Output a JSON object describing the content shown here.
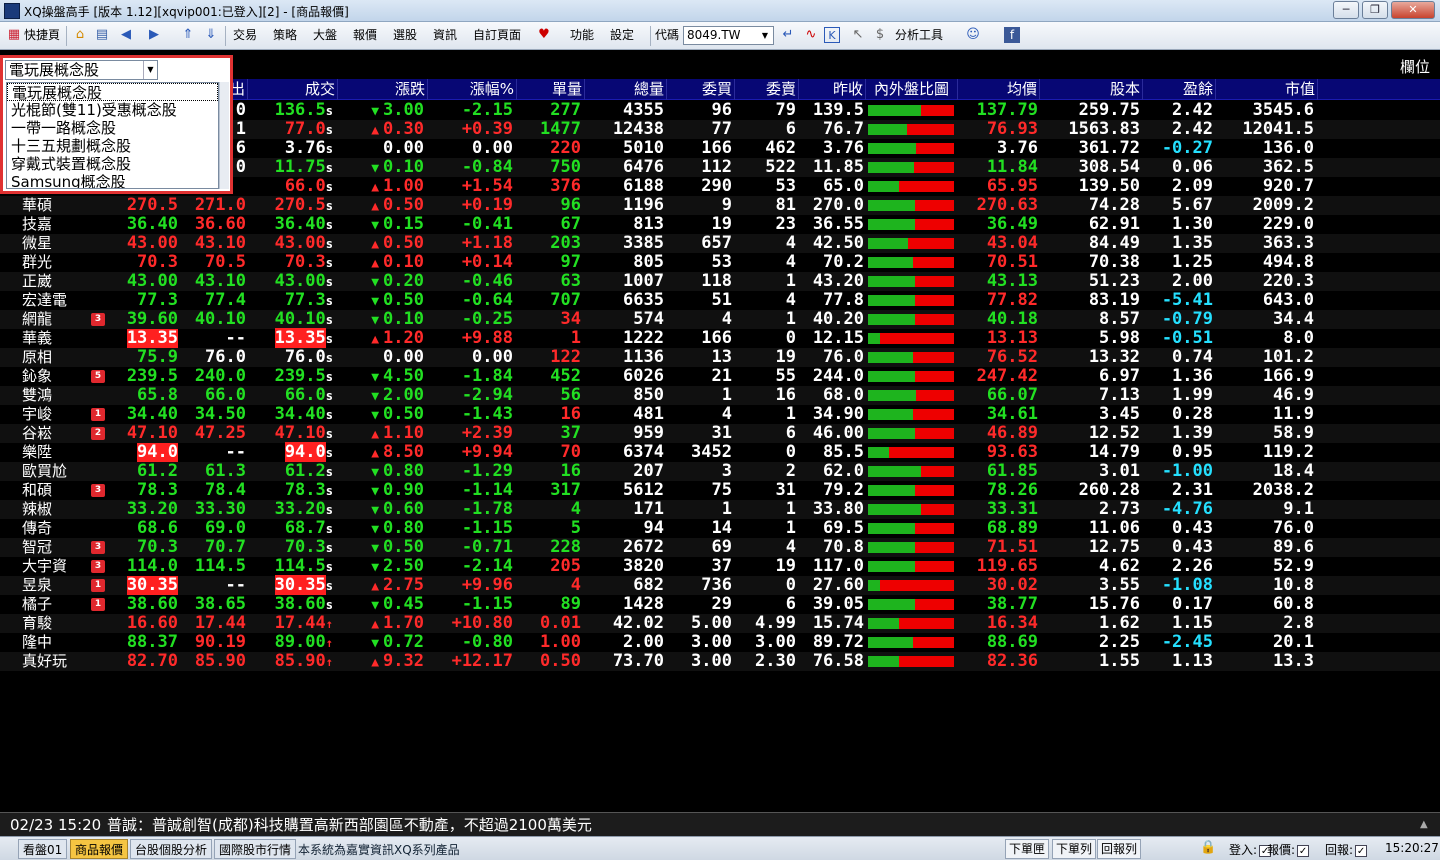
{
  "window": {
    "title": "XQ操盤高手 [版本 1.12][xqvip001:已登入][2] - [商品報價]",
    "minimize": "─",
    "restore": "❐",
    "close": "✕"
  },
  "toolbar": {
    "shortcut": "快捷頁",
    "trade": "交易",
    "strategy": "策略",
    "market": "大盤",
    "quote": "報價",
    "screener": "選股",
    "info": "資訊",
    "custom_page": "自訂頁面",
    "function": "功能",
    "settings": "設定",
    "code_label": "代碼",
    "code_value": "8049.TW",
    "analysis_tools": "分析工具"
  },
  "grid": {
    "field_label": "欄位"
  },
  "dropdown": {
    "selected": "電玩展概念股",
    "items": [
      "電玩展概念股",
      "光棍節(雙11)受惠概念股",
      "一帶一路概念股",
      "十三五規劃概念股",
      "穿戴式裝置概念股",
      "Samsung概念股"
    ]
  },
  "headers": [
    "出",
    "成交",
    "漲跌",
    "漲幅%",
    "單量",
    "總量",
    "委買",
    "委賣",
    "昨收",
    "內外盤比圖",
    "均價",
    "股本",
    "盈餘",
    "市值"
  ],
  "rows": [
    {
      "name": "",
      "badge": "",
      "bid": "",
      "ask": ".0",
      "last": "136.5",
      "lastsuf": "s",
      "arrow": "▼",
      "chg": "3.00",
      "pct": "-2.15",
      "vol": "277",
      "tot": "4355",
      "buy": "96",
      "sell": "79",
      "prev": "139.5",
      "ratio": 0.62,
      "avg": "137.79",
      "cap": "259.75",
      "eps": "2.42",
      "mkt": "3545.6",
      "c": {
        "last": "dn",
        "chg": "dn",
        "pct": "dn",
        "vol": "dn",
        "avg": "dn",
        "eps": "wh"
      }
    },
    {
      "name": "",
      "badge": "",
      "bid": "",
      "ask": ".1",
      "last": "77.0",
      "lastsuf": "s",
      "arrow": "▲",
      "chg": "0.30",
      "pct": "+0.39",
      "vol": "1477",
      "tot": "12438",
      "buy": "77",
      "sell": "6",
      "prev": "76.7",
      "ratio": 0.45,
      "avg": "76.93",
      "cap": "1563.83",
      "eps": "2.42",
      "mkt": "12041.5",
      "c": {
        "last": "up",
        "chg": "up",
        "pct": "up",
        "vol": "dn",
        "avg": "up",
        "eps": "wh"
      }
    },
    {
      "name": "",
      "badge": "",
      "bid": "",
      "ask": "6",
      "last": "3.76",
      "lastsuf": "s",
      "arrow": "",
      "chg": "0.00",
      "pct": "0.00",
      "vol": "220",
      "tot": "5010",
      "buy": "166",
      "sell": "462",
      "prev": "3.76",
      "ratio": 0.56,
      "avg": "3.76",
      "cap": "361.72",
      "eps": "-0.27",
      "mkt": "136.0",
      "c": {
        "last": "fl",
        "chg": "fl",
        "pct": "fl",
        "vol": "up",
        "avg": "fl",
        "eps": "cy"
      }
    },
    {
      "name": "",
      "badge": "",
      "bid": "",
      "ask": ".0",
      "last": "11.75",
      "lastsuf": "s",
      "arrow": "▼",
      "chg": "0.10",
      "pct": "-0.84",
      "vol": "750",
      "tot": "6476",
      "buy": "112",
      "sell": "522",
      "prev": "11.85",
      "ratio": 0.54,
      "avg": "11.84",
      "cap": "308.54",
      "eps": "0.06",
      "mkt": "362.5",
      "c": {
        "last": "dn",
        "chg": "dn",
        "pct": "dn",
        "vol": "dn",
        "avg": "dn",
        "eps": "wh"
      }
    },
    {
      "name": "",
      "badge": "",
      "bid": "",
      "ask": "",
      "last": "66.0",
      "lastsuf": "s",
      "arrow": "▲",
      "chg": "1.00",
      "pct": "+1.54",
      "vol": "376",
      "tot": "6188",
      "buy": "290",
      "sell": "53",
      "prev": "65.0",
      "ratio": 0.36,
      "avg": "65.95",
      "cap": "139.50",
      "eps": "2.09",
      "mkt": "920.7",
      "c": {
        "last": "up",
        "chg": "up",
        "pct": "up",
        "vol": "up",
        "avg": "up",
        "eps": "wh"
      }
    },
    {
      "name": "華碩",
      "badge": "",
      "bid": "270.5",
      "ask": "271.0",
      "last": "270.5",
      "lastsuf": "s",
      "arrow": "▲",
      "chg": "0.50",
      "pct": "+0.19",
      "vol": "96",
      "tot": "1196",
      "buy": "9",
      "sell": "81",
      "prev": "270.0",
      "ratio": 0.55,
      "avg": "270.63",
      "cap": "74.28",
      "eps": "5.67",
      "mkt": "2009.2",
      "c": {
        "bid": "up",
        "ask": "up",
        "last": "up",
        "chg": "up",
        "pct": "up",
        "vol": "dn",
        "avg": "up",
        "eps": "wh"
      }
    },
    {
      "name": "技嘉",
      "badge": "",
      "bid": "36.40",
      "ask": "36.60",
      "last": "36.40",
      "lastsuf": "s",
      "arrow": "▼",
      "chg": "0.15",
      "pct": "-0.41",
      "vol": "67",
      "tot": "813",
      "buy": "19",
      "sell": "23",
      "prev": "36.55",
      "ratio": 0.55,
      "avg": "36.49",
      "cap": "62.91",
      "eps": "1.30",
      "mkt": "229.0",
      "c": {
        "bid": "dn",
        "ask": "up",
        "last": "dn",
        "chg": "dn",
        "pct": "dn",
        "vol": "dn",
        "avg": "dn",
        "eps": "wh"
      }
    },
    {
      "name": "微星",
      "badge": "",
      "bid": "43.00",
      "ask": "43.10",
      "last": "43.00",
      "lastsuf": "s",
      "arrow": "▲",
      "chg": "0.50",
      "pct": "+1.18",
      "vol": "203",
      "tot": "3385",
      "buy": "657",
      "sell": "4",
      "prev": "42.50",
      "ratio": 0.46,
      "avg": "43.04",
      "cap": "84.49",
      "eps": "1.35",
      "mkt": "363.3",
      "c": {
        "bid": "up",
        "ask": "up",
        "last": "up",
        "chg": "up",
        "pct": "up",
        "vol": "dn",
        "avg": "up",
        "eps": "wh"
      }
    },
    {
      "name": "群光",
      "badge": "",
      "bid": "70.3",
      "ask": "70.5",
      "last": "70.3",
      "lastsuf": "s",
      "arrow": "▲",
      "chg": "0.10",
      "pct": "+0.14",
      "vol": "97",
      "tot": "805",
      "buy": "53",
      "sell": "4",
      "prev": "70.2",
      "ratio": 0.52,
      "avg": "70.51",
      "cap": "70.38",
      "eps": "1.25",
      "mkt": "494.8",
      "c": {
        "bid": "up",
        "ask": "up",
        "last": "up",
        "chg": "up",
        "pct": "up",
        "vol": "dn",
        "avg": "up",
        "eps": "wh"
      }
    },
    {
      "name": "正崴",
      "badge": "",
      "bid": "43.00",
      "ask": "43.10",
      "last": "43.00",
      "lastsuf": "s",
      "arrow": "▼",
      "chg": "0.20",
      "pct": "-0.46",
      "vol": "63",
      "tot": "1007",
      "buy": "118",
      "sell": "1",
      "prev": "43.20",
      "ratio": 0.55,
      "avg": "43.13",
      "cap": "51.23",
      "eps": "2.00",
      "mkt": "220.3",
      "c": {
        "bid": "dn",
        "ask": "dn",
        "last": "dn",
        "chg": "dn",
        "pct": "dn",
        "vol": "dn",
        "avg": "dn",
        "eps": "wh"
      }
    },
    {
      "name": "宏達電",
      "badge": "",
      "bid": "77.3",
      "ask": "77.4",
      "last": "77.3",
      "lastsuf": "s",
      "arrow": "▼",
      "chg": "0.50",
      "pct": "-0.64",
      "vol": "707",
      "tot": "6635",
      "buy": "51",
      "sell": "4",
      "prev": "77.8",
      "ratio": 0.55,
      "avg": "77.82",
      "cap": "83.19",
      "eps": "-5.41",
      "mkt": "643.0",
      "c": {
        "bid": "dn",
        "ask": "dn",
        "last": "dn",
        "chg": "dn",
        "pct": "dn",
        "vol": "dn",
        "avg": "up",
        "eps": "cy"
      }
    },
    {
      "name": "網龍",
      "badge": "3",
      "bid": "39.60",
      "ask": "40.10",
      "last": "40.10",
      "lastsuf": "s",
      "arrow": "▼",
      "chg": "0.10",
      "pct": "-0.25",
      "vol": "34",
      "tot": "574",
      "buy": "4",
      "sell": "1",
      "prev": "40.20",
      "ratio": 0.55,
      "avg": "40.18",
      "cap": "8.57",
      "eps": "-0.79",
      "mkt": "34.4",
      "c": {
        "bid": "dn",
        "ask": "dn",
        "last": "dn",
        "chg": "dn",
        "pct": "dn",
        "vol": "up",
        "avg": "dn",
        "eps": "cy"
      }
    },
    {
      "name": "華義",
      "badge": "",
      "bid": "13.35",
      "ask": "--",
      "last": "13.35",
      "lastsuf": "s",
      "arrow": "▲",
      "chg": "1.20",
      "pct": "+9.88",
      "vol": "1",
      "tot": "1222",
      "buy": "166",
      "sell": "0",
      "prev": "12.15",
      "ratio": 0.14,
      "avg": "13.13",
      "cap": "5.98",
      "eps": "-0.51",
      "mkt": "8.0",
      "c": {
        "bid": "lim",
        "ask": "wh",
        "last": "lim",
        "chg": "up",
        "pct": "up",
        "vol": "up",
        "avg": "up",
        "eps": "cy"
      }
    },
    {
      "name": "原相",
      "badge": "",
      "bid": "75.9",
      "ask": "76.0",
      "last": "76.0",
      "lastsuf": "s",
      "arrow": "",
      "chg": "0.00",
      "pct": "0.00",
      "vol": "122",
      "tot": "1136",
      "buy": "13",
      "sell": "19",
      "prev": "76.0",
      "ratio": 0.52,
      "avg": "76.52",
      "cap": "13.32",
      "eps": "0.74",
      "mkt": "101.2",
      "c": {
        "bid": "dn",
        "ask": "fl",
        "last": "fl",
        "chg": "fl",
        "pct": "fl",
        "vol": "up",
        "avg": "up",
        "eps": "wh"
      }
    },
    {
      "name": "鈊象",
      "badge": "5",
      "bid": "239.5",
      "ask": "240.0",
      "last": "239.5",
      "lastsuf": "s",
      "arrow": "▼",
      "chg": "4.50",
      "pct": "-1.84",
      "vol": "452",
      "tot": "6026",
      "buy": "21",
      "sell": "55",
      "prev": "244.0",
      "ratio": 0.55,
      "avg": "247.42",
      "cap": "6.97",
      "eps": "1.36",
      "mkt": "166.9",
      "c": {
        "bid": "dn",
        "ask": "dn",
        "last": "dn",
        "chg": "dn",
        "pct": "dn",
        "vol": "dn",
        "avg": "up",
        "eps": "wh"
      }
    },
    {
      "name": "雙鴻",
      "badge": "",
      "bid": "65.8",
      "ask": "66.0",
      "last": "66.0",
      "lastsuf": "s",
      "arrow": "▼",
      "chg": "2.00",
      "pct": "-2.94",
      "vol": "56",
      "tot": "850",
      "buy": "1",
      "sell": "16",
      "prev": "68.0",
      "ratio": 0.56,
      "avg": "66.07",
      "cap": "7.13",
      "eps": "1.99",
      "mkt": "46.9",
      "c": {
        "bid": "dn",
        "ask": "dn",
        "last": "dn",
        "chg": "dn",
        "pct": "dn",
        "vol": "dn",
        "avg": "dn",
        "eps": "wh"
      }
    },
    {
      "name": "宇峻",
      "badge": "1",
      "bid": "34.40",
      "ask": "34.50",
      "last": "34.40",
      "lastsuf": "s",
      "arrow": "▼",
      "chg": "0.50",
      "pct": "-1.43",
      "vol": "16",
      "tot": "481",
      "buy": "4",
      "sell": "1",
      "prev": "34.90",
      "ratio": 0.52,
      "avg": "34.61",
      "cap": "3.45",
      "eps": "0.28",
      "mkt": "11.9",
      "c": {
        "bid": "dn",
        "ask": "dn",
        "last": "dn",
        "chg": "dn",
        "pct": "dn",
        "vol": "up",
        "avg": "dn",
        "eps": "wh"
      }
    },
    {
      "name": "谷崧",
      "badge": "2",
      "bid": "47.10",
      "ask": "47.25",
      "last": "47.10",
      "lastsuf": "s",
      "arrow": "▲",
      "chg": "1.10",
      "pct": "+2.39",
      "vol": "37",
      "tot": "959",
      "buy": "31",
      "sell": "6",
      "prev": "46.00",
      "ratio": 0.55,
      "avg": "46.89",
      "cap": "12.52",
      "eps": "1.39",
      "mkt": "58.9",
      "c": {
        "bid": "up",
        "ask": "up",
        "last": "up",
        "chg": "up",
        "pct": "up",
        "vol": "dn",
        "avg": "up",
        "eps": "wh"
      }
    },
    {
      "name": "樂陞",
      "badge": "",
      "bid": "94.0",
      "ask": "--",
      "last": "94.0",
      "lastsuf": "s",
      "arrow": "▲",
      "chg": "8.50",
      "pct": "+9.94",
      "vol": "70",
      "tot": "6374",
      "buy": "3452",
      "sell": "0",
      "prev": "85.5",
      "ratio": 0.24,
      "avg": "93.63",
      "cap": "14.79",
      "eps": "0.95",
      "mkt": "119.2",
      "c": {
        "bid": "lim",
        "ask": "wh",
        "last": "lim",
        "chg": "up",
        "pct": "up",
        "vol": "up",
        "avg": "up",
        "eps": "wh"
      }
    },
    {
      "name": "歐買尬",
      "badge": "",
      "bid": "61.2",
      "ask": "61.3",
      "last": "61.2",
      "lastsuf": "s",
      "arrow": "▼",
      "chg": "0.80",
      "pct": "-1.29",
      "vol": "16",
      "tot": "207",
      "buy": "3",
      "sell": "2",
      "prev": "62.0",
      "ratio": 0.62,
      "avg": "61.85",
      "cap": "3.01",
      "eps": "-1.00",
      "mkt": "18.4",
      "c": {
        "bid": "dn",
        "ask": "dn",
        "last": "dn",
        "chg": "dn",
        "pct": "dn",
        "vol": "dn",
        "avg": "dn",
        "eps": "cy"
      }
    },
    {
      "name": "和碩",
      "badge": "3",
      "bid": "78.3",
      "ask": "78.4",
      "last": "78.3",
      "lastsuf": "s",
      "arrow": "▼",
      "chg": "0.90",
      "pct": "-1.14",
      "vol": "317",
      "tot": "5612",
      "buy": "75",
      "sell": "31",
      "prev": "79.2",
      "ratio": 0.55,
      "avg": "78.26",
      "cap": "260.28",
      "eps": "2.31",
      "mkt": "2038.2",
      "c": {
        "bid": "dn",
        "ask": "dn",
        "last": "dn",
        "chg": "dn",
        "pct": "dn",
        "vol": "dn",
        "avg": "dn",
        "eps": "wh"
      }
    },
    {
      "name": "辣椒",
      "badge": "",
      "bid": "33.20",
      "ask": "33.30",
      "last": "33.20",
      "lastsuf": "s",
      "arrow": "▼",
      "chg": "0.60",
      "pct": "-1.78",
      "vol": "4",
      "tot": "171",
      "buy": "1",
      "sell": "1",
      "prev": "33.80",
      "ratio": 0.62,
      "avg": "33.31",
      "cap": "2.73",
      "eps": "-4.76",
      "mkt": "9.1",
      "c": {
        "bid": "dn",
        "ask": "dn",
        "last": "dn",
        "chg": "dn",
        "pct": "dn",
        "vol": "dn",
        "avg": "dn",
        "eps": "cy"
      }
    },
    {
      "name": "傳奇",
      "badge": "",
      "bid": "68.6",
      "ask": "69.0",
      "last": "68.7",
      "lastsuf": "s",
      "arrow": "▼",
      "chg": "0.80",
      "pct": "-1.15",
      "vol": "5",
      "tot": "94",
      "buy": "14",
      "sell": "1",
      "prev": "69.5",
      "ratio": 0.55,
      "avg": "68.89",
      "cap": "11.06",
      "eps": "0.43",
      "mkt": "76.0",
      "c": {
        "bid": "dn",
        "ask": "dn",
        "last": "dn",
        "chg": "dn",
        "pct": "dn",
        "vol": "dn",
        "avg": "dn",
        "eps": "wh"
      }
    },
    {
      "name": "智冠",
      "badge": "3",
      "bid": "70.3",
      "ask": "70.7",
      "last": "70.3",
      "lastsuf": "s",
      "arrow": "▼",
      "chg": "0.50",
      "pct": "-0.71",
      "vol": "228",
      "tot": "2672",
      "buy": "69",
      "sell": "4",
      "prev": "70.8",
      "ratio": 0.55,
      "avg": "71.51",
      "cap": "12.75",
      "eps": "0.43",
      "mkt": "89.6",
      "c": {
        "bid": "dn",
        "ask": "dn",
        "last": "dn",
        "chg": "dn",
        "pct": "dn",
        "vol": "dn",
        "avg": "up",
        "eps": "wh"
      }
    },
    {
      "name": "大宇資",
      "badge": "3",
      "bid": "114.0",
      "ask": "114.5",
      "last": "114.5",
      "lastsuf": "s",
      "arrow": "▼",
      "chg": "2.50",
      "pct": "-2.14",
      "vol": "205",
      "tot": "3820",
      "buy": "37",
      "sell": "19",
      "prev": "117.0",
      "ratio": 0.55,
      "avg": "119.65",
      "cap": "4.62",
      "eps": "2.26",
      "mkt": "52.9",
      "c": {
        "bid": "dn",
        "ask": "dn",
        "last": "dn",
        "chg": "dn",
        "pct": "dn",
        "vol": "up",
        "avg": "up",
        "eps": "wh"
      }
    },
    {
      "name": "昱泉",
      "badge": "1",
      "bid": "30.35",
      "ask": "--",
      "last": "30.35",
      "lastsuf": "s",
      "arrow": "▲",
      "chg": "2.75",
      "pct": "+9.96",
      "vol": "4",
      "tot": "682",
      "buy": "736",
      "sell": "0",
      "prev": "27.60",
      "ratio": 0.14,
      "avg": "30.02",
      "cap": "3.55",
      "eps": "-1.08",
      "mkt": "10.8",
      "c": {
        "bid": "lim",
        "ask": "wh",
        "last": "lim",
        "chg": "up",
        "pct": "up",
        "vol": "up",
        "avg": "up",
        "eps": "cy"
      }
    },
    {
      "name": "橘子",
      "badge": "1",
      "bid": "38.60",
      "ask": "38.65",
      "last": "38.60",
      "lastsuf": "s",
      "arrow": "▼",
      "chg": "0.45",
      "pct": "-1.15",
      "vol": "89",
      "tot": "1428",
      "buy": "29",
      "sell": "6",
      "prev": "39.05",
      "ratio": 0.55,
      "avg": "38.77",
      "cap": "15.76",
      "eps": "0.17",
      "mkt": "60.8",
      "c": {
        "bid": "dn",
        "ask": "dn",
        "last": "dn",
        "chg": "dn",
        "pct": "dn",
        "vol": "dn",
        "avg": "dn",
        "eps": "wh"
      }
    },
    {
      "name": "育駿",
      "badge": "",
      "bid": "16.60",
      "ask": "17.44",
      "last": "17.44",
      "lastsuf": "↑",
      "arrow": "▲",
      "chg": "1.70",
      "pct": "+10.80",
      "vol": "0.01",
      "tot": "42.02",
      "buy": "5.00",
      "sell": "4.99",
      "prev": "15.74",
      "ratio": 0.36,
      "avg": "16.34",
      "cap": "1.62",
      "eps": "1.15",
      "mkt": "2.8",
      "c": {
        "bid": "up",
        "ask": "up",
        "last": "up",
        "chg": "up",
        "pct": "up",
        "vol": "up",
        "avg": "up",
        "eps": "wh"
      }
    },
    {
      "name": "隆中",
      "badge": "",
      "bid": "88.37",
      "ask": "90.19",
      "last": "89.00",
      "lastsuf": "↑",
      "arrow": "▼",
      "chg": "0.72",
      "pct": "-0.80",
      "vol": "1.00",
      "tot": "2.00",
      "buy": "3.00",
      "sell": "3.00",
      "prev": "89.72",
      "ratio": 0.52,
      "avg": "88.69",
      "cap": "2.25",
      "eps": "-2.45",
      "mkt": "20.1",
      "c": {
        "bid": "dn",
        "ask": "up",
        "last": "dn",
        "chg": "dn",
        "pct": "dn",
        "vol": "up",
        "avg": "dn",
        "eps": "cy"
      }
    },
    {
      "name": "真好玩",
      "badge": "",
      "bid": "82.70",
      "ask": "85.90",
      "last": "85.90",
      "lastsuf": "↑",
      "arrow": "▲",
      "chg": "9.32",
      "pct": "+12.17",
      "vol": "0.50",
      "tot": "73.70",
      "buy": "3.00",
      "sell": "2.30",
      "prev": "76.58",
      "ratio": 0.36,
      "avg": "82.36",
      "cap": "1.55",
      "eps": "1.13",
      "mkt": "13.3",
      "c": {
        "bid": "up",
        "ask": "up",
        "last": "up",
        "chg": "up",
        "pct": "up",
        "vol": "up",
        "avg": "up",
        "eps": "wh"
      }
    }
  ],
  "marquee": {
    "time": "02/23 15:20",
    "text": "普誠：普誠創智(成都)科技購置高新西部園區不動產，不超過2100萬美元"
  },
  "tabs": [
    "看盤01",
    "商品報價",
    "台股個股分析",
    "國際股市行情"
  ],
  "statusbar": {
    "notice": "本系統為嘉實資訊XQ系列產品",
    "order_list": "下單匣",
    "order_row": "下單列",
    "report_row": "回報列",
    "login": "登入:",
    "report": "報價:",
    "callback": "回報:",
    "clock": "15:20:27"
  },
  "colors": {
    "up": "#ff2a2a",
    "down": "#22e022",
    "flat": "#ffffff",
    "header_bg": "#070774",
    "accent_outline": "#e03232"
  }
}
